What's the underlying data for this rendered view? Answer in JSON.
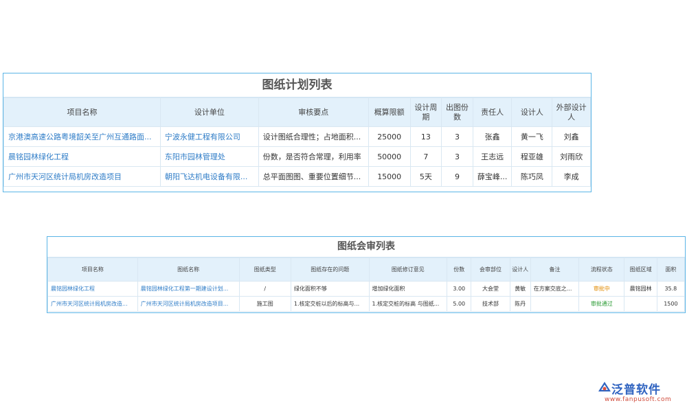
{
  "plan_table": {
    "title": "图纸计划列表",
    "headers": [
      "项目名称",
      "设计单位",
      "审核要点",
      "概算限额",
      "设计周期",
      "出图份数",
      "责任人",
      "设计人",
      "外部设计人"
    ],
    "rows": [
      [
        "京港澳高速公路粤境韶关至广州互通路面...",
        "宁波永健工程有限公司",
        "设计图纸合理性；占地面积...",
        "25000",
        "13",
        "3",
        "张鑫",
        "黄一飞",
        "刘鑫"
      ],
      [
        "晨铭园林绿化工程",
        "东阳市园林管理处",
        "份数，是否符合常理，利用率",
        "50000",
        "7",
        "3",
        "王志远",
        "程亚雄",
        "刘雨欣"
      ],
      [
        "广州市天河区统计局机房改造项目",
        "朝阳飞达机电设备有限...",
        "总平面图图、重要位置细节...",
        "15000",
        "5天",
        "9",
        "薛宝峰...",
        "陈巧凤",
        "李成"
      ]
    ]
  },
  "review_table": {
    "title": "图纸会审列表",
    "headers": [
      "项目名称",
      "图纸名称",
      "图纸类型",
      "图纸存在的问题",
      "图纸修订意见",
      "份数",
      "会审部位",
      "设计人",
      "备注",
      "流程状态",
      "图纸区域",
      "面积"
    ],
    "rows": [
      [
        "晨铭园林绿化工程",
        "晨铭园林绿化工程第一期建设计划...",
        "/",
        "绿化面积不够",
        "增加绿化面积",
        "3.00",
        "大会堂",
        "黄敏",
        "在方案交底之...",
        "审批中",
        "晨铭园林",
        "35.8"
      ],
      [
        "广州市天河区统计局机房改造...",
        "广州市天河区统计局机房改造项目...",
        "施工图",
        "1.核定交桩以后的标高与...",
        "1.核定交桩的标高 与图纸...",
        "5.00",
        "技术部",
        "陈丹",
        "",
        "审批通过",
        "",
        "1500"
      ]
    ]
  },
  "logo": {
    "brand": "泛普软件",
    "url": "www.fanpusoft.com"
  }
}
